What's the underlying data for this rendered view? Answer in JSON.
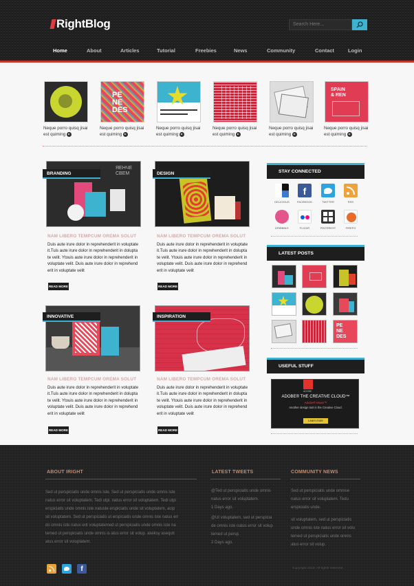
{
  "header": {
    "logo": "RightBlog",
    "search_placeholder": "Search Here...",
    "nav": [
      "Home",
      "About",
      "Articles",
      "Tutorial",
      "Freebies",
      "News",
      "Community",
      "Contact",
      "Login"
    ],
    "active_nav": "Home"
  },
  "featured": {
    "caption_line1": "Neque porro quisq jisai",
    "caption_line2": "est quiming"
  },
  "posts": [
    {
      "label": "BRANDING",
      "title": "NAM LIBERO TEMPCUM OREMA SOLUT",
      "text": "Duis aute irure dolor in reprehenderit in voluptate it.Tuis aute irure dolor in reprehenderit in dolupta te velit. Ytouis aute irure dolor in reprehenderit in voluptate velit. Duis aute irure dolor in reprehend erit in voluptate velit",
      "button": "READ MORE"
    },
    {
      "label": "DESIGN",
      "title": "NAM LIBERO TEMPCUM OREMA SOLUT",
      "text": "Duis aute irure dolor in reprehenderit in voluptate it.Tuis aute irure dolor in reprehenderit in dolupta te velit. Ytouis aute irure dolor in reprehenderit in voluptate velit. Duis aute irure dolor in reprehend erit in voluptate velit",
      "button": "READ MORE"
    },
    {
      "label": "INNOVATIVE",
      "title": "NAM LIBERO TEMPCUM OREMA SOLUT",
      "text": "Duis aute irure dolor in reprehenderit in voluptate it.Tuis aute irure dolor in reprehenderit in dolupta te velit. Ytouis aute irure dolor in reprehenderit in voluptate velit. Duis aute irure dolor in reprehend erit in voluptate velit",
      "button": "READ MORE"
    },
    {
      "label": "INSPIRATION",
      "title": "NAM LIBERO TEMPCUM OREMA SOLUT",
      "text": "Duis aute irure dolor in reprehenderit in voluptate it.Tuis aute irure dolor in reprehenderit in dolupta te velit. Ytouis aute irure dolor in reprehenderit in voluptate velit. Duis aute irure dolor in reprehend erit in voluptate velit",
      "button": "READ MORE"
    }
  ],
  "sidebar": {
    "stay_connected": "STAY CONNECTED",
    "social": [
      {
        "name": "DELICIOUS",
        "icon": "delicious-icon",
        "color": "#ffffff"
      },
      {
        "name": "FACEBOOK",
        "icon": "facebook-icon",
        "color": "#3b5998"
      },
      {
        "name": "TWITTER",
        "icon": "twitter-icon",
        "color": "#2fa3dd"
      },
      {
        "name": "RSS",
        "icon": "rss-icon",
        "color": "#f0a13a"
      },
      {
        "name": "DRIBBBLE",
        "icon": "dribbble-icon",
        "color": "#e4558d"
      },
      {
        "name": "FLICKR",
        "icon": "flickr-icon",
        "color": "#ffffff"
      },
      {
        "name": "PINTEREST",
        "icon": "pinterest-icon",
        "color": "#333333"
      },
      {
        "name": "FIREFO",
        "icon": "firefox-icon",
        "color": "#e96b2c"
      }
    ],
    "latest_posts": "LATEST POSTS",
    "useful_stuff": "USEFUL STUFF",
    "ad": {
      "brand": "ADOBE",
      "title": "ADOBE® THE CREATIVE CLOUD™",
      "sub1": "Adobe® Muse™",
      "sub2": "Another design tool in the Creative Cloud.",
      "button": "Learn more"
    }
  },
  "footer": {
    "about_title": "ABOUT IRIGHT",
    "about_text": [
      "Sed ut perspiciatis unde omnis iste. Sed ut perspiciatis unde omnis iste",
      "natus error sit voluptatem. Tedi utpi. natus error sit voluptatem. Tedi utpi",
      "erspiciatis unde omnis iste natuste erspiciatis unde sit voluptatem, acip",
      "sit voluptatem. Sed ut perspiciatis ut erspiciatis unde omnis iste natus err",
      "do omnis iste natus erit voluptatemed ut perspiciatis unde omnis iste na",
      "temed ut perspiciatis unde omnis is atus error sit volup. ateiksy asequti",
      "atus error sit voluptatem."
    ],
    "tweets_title": "LATEST TWEETS",
    "tweets": [
      {
        "lines": [
          "@Ted ut perspiciatis unde omnis",
          "natus error sit voluptatem.",
          "1 Days ago."
        ]
      },
      {
        "lines": [
          "@Ut voluptatem, sed ut perspicia",
          "de omnis iste natus error sit volup",
          "temed ut persp.",
          "2 Days ago."
        ]
      }
    ],
    "community_title": "COMMUNITY NEWS",
    "community": [
      {
        "lines": [
          "Sed ut perspiciatis unde omnise",
          "natus error sit voluptatem. Tedu",
          "erspiciatis unde."
        ]
      },
      {
        "lines": [
          "sit voluptatem, sed ut perspiciatis",
          "unde omnis iste natus error sit volu",
          "temed ut perspiciatis unde omnis",
          "atus error sit volup."
        ]
      }
    ],
    "copyright": "Copyright 2012. All rights reserved.",
    "social_icons": [
      "rss-icon",
      "twitter-icon",
      "facebook-icon"
    ]
  }
}
